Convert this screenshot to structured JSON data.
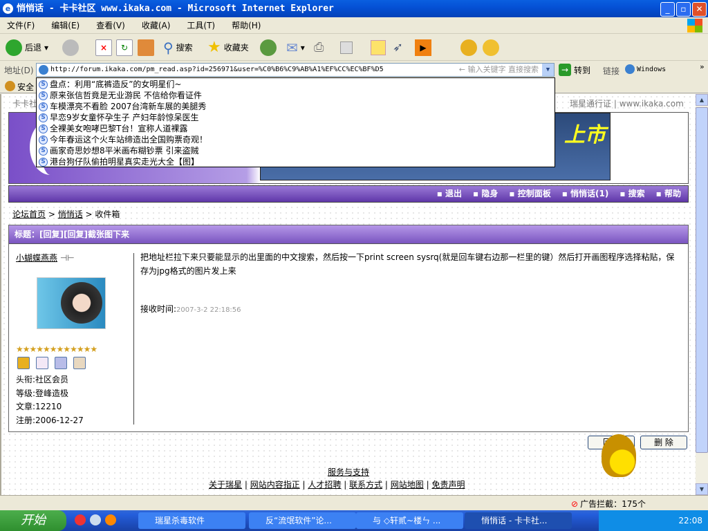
{
  "window": {
    "title": "悄悄话 - 卡卡社区 www.ikaka.com - Microsoft Internet Explorer"
  },
  "menu": [
    "文件(F)",
    "编辑(E)",
    "查看(V)",
    "收藏(A)",
    "工具(T)",
    "帮助(H)"
  ],
  "toolbar": {
    "back": "后退",
    "search": "搜索",
    "favorites": "收藏夹"
  },
  "address": {
    "label": "地址(D)",
    "url": "http://forum.ikaka.com/pm_read.asp?id=256971&user=%C0%B6%C9%AB%A1%EF%CC%EC%BF%D5",
    "hint": "输入关键字 直接搜索",
    "go": "转到",
    "links": "链接",
    "windows": "Windows",
    "security": "安全"
  },
  "dropdown": [
    "盘点：利用“底裤造反”的女明星们~",
    "原来张信哲竟是无业游民 不信给你看证件",
    "车模漂亮不看脸 2007台湾新车展的美腿秀",
    "早恋9岁女童怀孕生子 产妇年龄惊呆医生",
    "全裸美女咆哮巴黎T台！宣称人道裸露",
    "今年春运这个火车站缔造出全国购票奇观！",
    "画家奇思妙想8平米画布糊钞票 引来盗贼",
    "港台狗仔队偷拍明星真实走光大全【图】"
  ],
  "header": {
    "left": "卡卡社区",
    "passport": "瑞星通行证",
    "site": "www.ikaka.com",
    "banner_text": "上市"
  },
  "nav": [
    "退出",
    "隐身",
    "控制面板",
    "悄悄话(1)",
    "搜索",
    "帮助"
  ],
  "breadcrumb": [
    "论坛首页",
    "悄悄话",
    "收件箱"
  ],
  "post": {
    "title": "标题：[回复][回复]截张图下来",
    "author": "小蝴蝶燕燕",
    "body": "把地址栏拉下来只要能显示的出里面的中文搜索，然后按一下print screen sysrq(就是回车键右边那一栏里的键）然后打开画图程序选择粘贴，保存为jpg格式的图片发上来",
    "time_label": "接收时间:",
    "time": "2007-3-2 22:18:56",
    "stars": 12,
    "info": [
      "头衔:社区会员",
      "等级:登峰造极",
      "文章:12210",
      "注册:2006-12-27"
    ]
  },
  "buttons": {
    "reply": "回复",
    "delete": "删 除"
  },
  "footer": {
    "title": "服务与支持",
    "links": [
      "关于瑞星",
      "网站内容指正",
      "人才招聘",
      "联系方式",
      "网站地图",
      "免责声明"
    ]
  },
  "status": {
    "adblock": "广告拦截：175个"
  },
  "taskbar": {
    "start": "开始",
    "tasks": [
      "瑞星杀毒软件",
      "反“流氓软件”论...",
      "与 ◇轩贰~楼ㄣ ...",
      "悄悄话 - 卡卡社..."
    ],
    "clock": "22:08"
  }
}
